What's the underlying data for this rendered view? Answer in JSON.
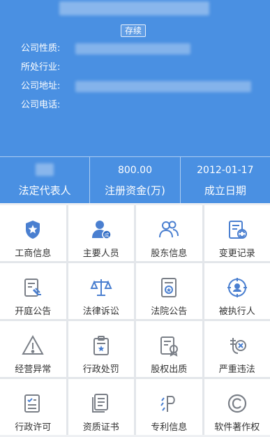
{
  "header": {
    "status": "存续",
    "info": [
      {
        "label": "公司性质:"
      },
      {
        "label": "所处行业:"
      },
      {
        "label": "公司地址:"
      },
      {
        "label": "公司电话:"
      }
    ]
  },
  "stats": [
    {
      "value": "",
      "label": "法定代表人"
    },
    {
      "value": "800.00",
      "label": "注册资金(万)"
    },
    {
      "value": "2012-01-17",
      "label": "成立日期"
    }
  ],
  "menu": [
    {
      "label": "工商信息",
      "icon": "police-badge-icon"
    },
    {
      "label": "主要人员",
      "icon": "person-icon"
    },
    {
      "label": "股东信息",
      "icon": "users-icon"
    },
    {
      "label": "变更记录",
      "icon": "change-record-icon"
    },
    {
      "label": "开庭公告",
      "icon": "gavel-document-icon"
    },
    {
      "label": "法律诉讼",
      "icon": "scales-icon"
    },
    {
      "label": "法院公告",
      "icon": "court-document-icon"
    },
    {
      "label": "被执行人",
      "icon": "target-person-icon"
    },
    {
      "label": "经营异常",
      "icon": "warning-icon"
    },
    {
      "label": "行政处罚",
      "icon": "star-badge-icon"
    },
    {
      "label": "股权出质",
      "icon": "certificate-icon"
    },
    {
      "label": "严重违法",
      "icon": "violation-icon"
    },
    {
      "label": "行政许可",
      "icon": "checklist-icon"
    },
    {
      "label": "资质证书",
      "icon": "documents-icon"
    },
    {
      "label": "专利信息",
      "icon": "patent-icon"
    },
    {
      "label": "软件著作权",
      "icon": "copyright-icon"
    }
  ],
  "colors": {
    "primary": "#4a90e2",
    "icon_blue": "#4a7fd0",
    "icon_gray": "#7a7f87"
  }
}
